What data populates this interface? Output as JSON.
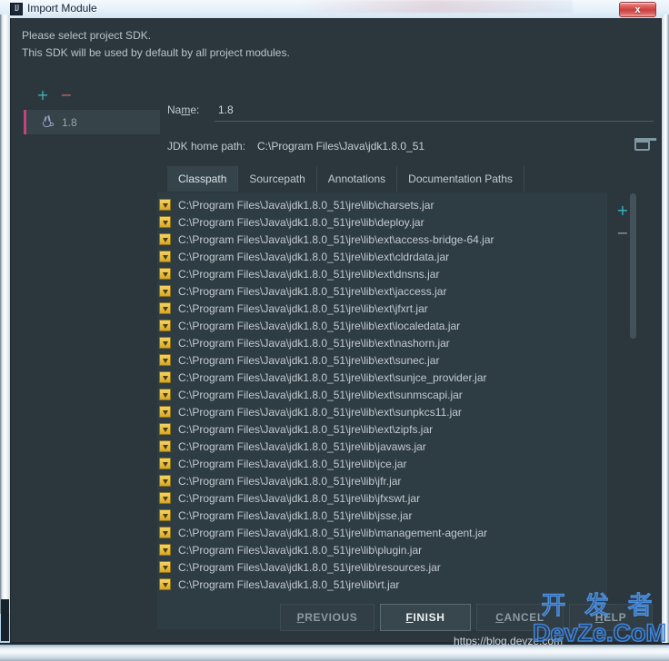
{
  "window": {
    "title": "Import Module",
    "app_icon": "intellij-idea-icon",
    "close_label": "x"
  },
  "intro": {
    "line1": "Please select project SDK.",
    "line2": "This SDK will be used by default by all project modules."
  },
  "sdk_panel": {
    "add_label": "+",
    "remove_label": "−",
    "items": [
      {
        "label": "1.8",
        "icon": "java-sdk-icon",
        "selected": true
      }
    ]
  },
  "form": {
    "name_label_pre": "Na",
    "name_label_mnemonic": "m",
    "name_label_post": "e:",
    "name_value": "1.8",
    "name_placeholder": "",
    "jdk_home_label": "JDK home path:",
    "jdk_home_value": "C:\\Program Files\\Java\\jdk1.8.0_51",
    "browse_icon": "folder-icon"
  },
  "tabs": [
    {
      "label": "Classpath",
      "active": true
    },
    {
      "label": "Sourcepath",
      "active": false
    },
    {
      "label": "Annotations",
      "active": false
    },
    {
      "label": "Documentation Paths",
      "active": false
    }
  ],
  "classpath": {
    "add_label": "+",
    "remove_label": "−",
    "entries": [
      "C:\\Program Files\\Java\\jdk1.8.0_51\\jre\\lib\\charsets.jar",
      "C:\\Program Files\\Java\\jdk1.8.0_51\\jre\\lib\\deploy.jar",
      "C:\\Program Files\\Java\\jdk1.8.0_51\\jre\\lib\\ext\\access-bridge-64.jar",
      "C:\\Program Files\\Java\\jdk1.8.0_51\\jre\\lib\\ext\\cldrdata.jar",
      "C:\\Program Files\\Java\\jdk1.8.0_51\\jre\\lib\\ext\\dnsns.jar",
      "C:\\Program Files\\Java\\jdk1.8.0_51\\jre\\lib\\ext\\jaccess.jar",
      "C:\\Program Files\\Java\\jdk1.8.0_51\\jre\\lib\\ext\\jfxrt.jar",
      "C:\\Program Files\\Java\\jdk1.8.0_51\\jre\\lib\\ext\\localedata.jar",
      "C:\\Program Files\\Java\\jdk1.8.0_51\\jre\\lib\\ext\\nashorn.jar",
      "C:\\Program Files\\Java\\jdk1.8.0_51\\jre\\lib\\ext\\sunec.jar",
      "C:\\Program Files\\Java\\jdk1.8.0_51\\jre\\lib\\ext\\sunjce_provider.jar",
      "C:\\Program Files\\Java\\jdk1.8.0_51\\jre\\lib\\ext\\sunmscapi.jar",
      "C:\\Program Files\\Java\\jdk1.8.0_51\\jre\\lib\\ext\\sunpkcs11.jar",
      "C:\\Program Files\\Java\\jdk1.8.0_51\\jre\\lib\\ext\\zipfs.jar",
      "C:\\Program Files\\Java\\jdk1.8.0_51\\jre\\lib\\javaws.jar",
      "C:\\Program Files\\Java\\jdk1.8.0_51\\jre\\lib\\jce.jar",
      "C:\\Program Files\\Java\\jdk1.8.0_51\\jre\\lib\\jfr.jar",
      "C:\\Program Files\\Java\\jdk1.8.0_51\\jre\\lib\\jfxswt.jar",
      "C:\\Program Files\\Java\\jdk1.8.0_51\\jre\\lib\\jsse.jar",
      "C:\\Program Files\\Java\\jdk1.8.0_51\\jre\\lib\\management-agent.jar",
      "C:\\Program Files\\Java\\jdk1.8.0_51\\jre\\lib\\plugin.jar",
      "C:\\Program Files\\Java\\jdk1.8.0_51\\jre\\lib\\resources.jar",
      "C:\\Program Files\\Java\\jdk1.8.0_51\\jre\\lib\\rt.jar"
    ]
  },
  "buttons": {
    "previous": {
      "pre": "",
      "mnemonic": "P",
      "post": "REVIOUS",
      "primary": false
    },
    "finish": {
      "pre": "",
      "mnemonic": "F",
      "post": "INISH",
      "primary": true
    },
    "cancel": {
      "pre": "",
      "mnemonic": "C",
      "post": "ANCEL",
      "primary": false
    },
    "help": {
      "pre": "",
      "mnemonic": "H",
      "post": "ELP",
      "primary": false
    }
  },
  "watermark": {
    "url": "https://blog.devze.com",
    "cn": "开 发 者",
    "en": "DevZe.CoM"
  },
  "colors": {
    "dialog_bg": "#2b373d",
    "panel_bg": "#2e3c43",
    "text": "#c3ccd1",
    "accent_add": "#37b6c6",
    "accent_remove": "#bd6a6a",
    "selection_bar": "#c0457c",
    "jar_icon": "#e7bd3e",
    "close_button": "#cc3f3d"
  }
}
